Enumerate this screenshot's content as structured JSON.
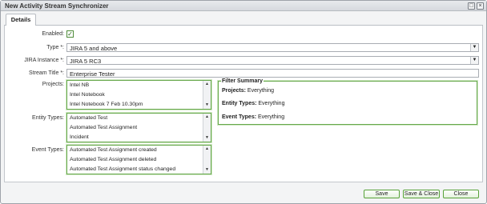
{
  "window": {
    "title": "New Activity Stream Synchronizer"
  },
  "tabs": [
    {
      "label": "Details"
    }
  ],
  "form": {
    "enabled": {
      "label": "Enabled:",
      "checked": true
    },
    "type": {
      "label": "Type *:",
      "value": "JIRA 5 and above"
    },
    "jira_instance": {
      "label": "JIRA Instance *:",
      "value": "JIRA 5 RC3"
    },
    "stream_title": {
      "label": "Stream Title *:",
      "value": "Enterprise Tester"
    },
    "projects": {
      "label": "Projects:",
      "items": [
        "Intel NB",
        "Intel Notebook",
        "Intel Notebook 7 Feb 10.30pm"
      ]
    },
    "entity_types": {
      "label": "Entity Types:",
      "items": [
        "Automated Test",
        "Automated Test Assignment",
        "Incident"
      ]
    },
    "event_types": {
      "label": "Event Types:",
      "items": [
        "Automated Test Assignment created",
        "Automated Test Assignment deleted",
        "Automated Test Assignment status changed"
      ]
    }
  },
  "filter_summary": {
    "title": "Filter Summary",
    "projects": {
      "label": "Projects:",
      "value": "Everything"
    },
    "entity_types": {
      "label": "Entity Types:",
      "value": "Everything"
    },
    "event_types": {
      "label": "Event Types:",
      "value": "Everything"
    }
  },
  "buttons": {
    "save": "Save",
    "save_close": "Save & Close",
    "close": "Close"
  },
  "colors": {
    "accent_green": "#67a84c",
    "button_border": "#58a23a",
    "titlebar": "#d6d9de"
  }
}
